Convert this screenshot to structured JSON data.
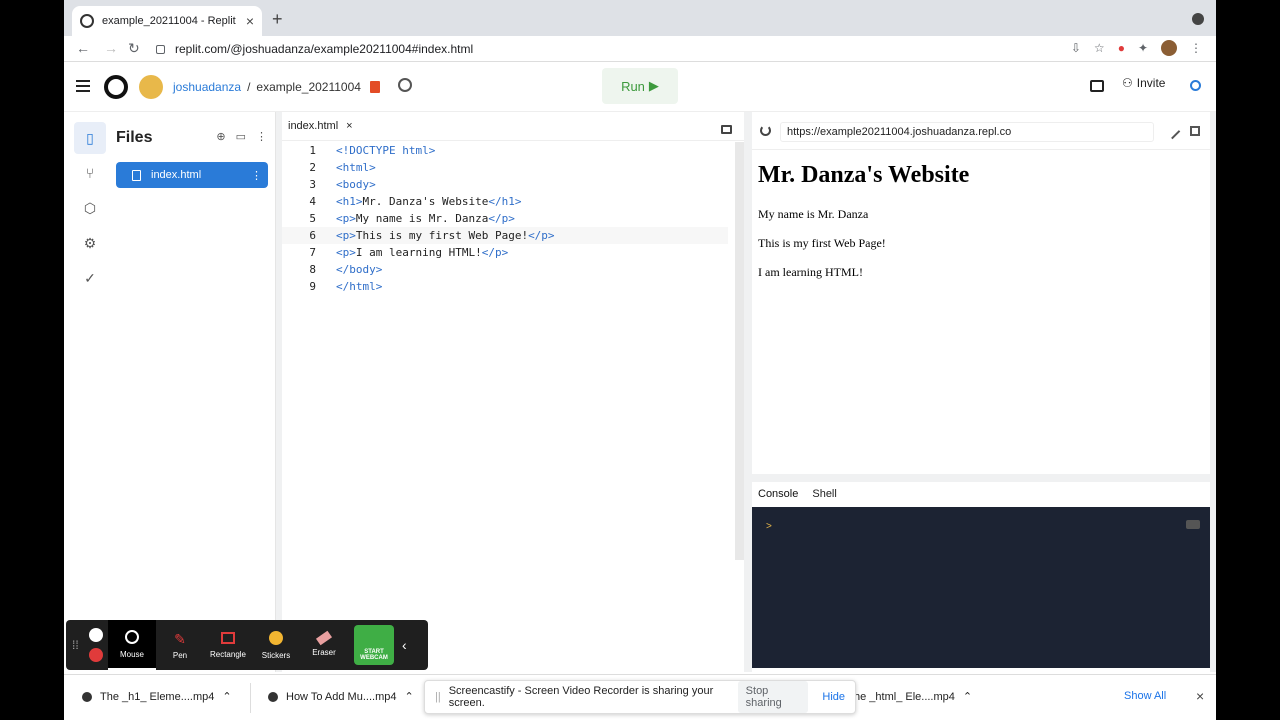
{
  "browser": {
    "tab_title": "example_20211004 - Replit",
    "tab_close": "×",
    "new_tab": "+",
    "url": "replit.com/@joshuadanza/example20211004#index.html"
  },
  "header": {
    "username": "joshuadanza",
    "separator": "/",
    "repl_name": "example_20211004",
    "run_label": "Run",
    "run_glyph": "▶",
    "invite_label": "Invite"
  },
  "files": {
    "title": "Files",
    "items": [
      {
        "label": "index.html"
      }
    ]
  },
  "editor": {
    "tab_label": "index.html",
    "tab_close": "×",
    "lines": [
      {
        "n": "1",
        "html": "<!DOCTYPE html>"
      },
      {
        "n": "2",
        "html": "<html>"
      },
      {
        "n": "3",
        "html": "<body>"
      },
      {
        "n": "4",
        "html": "<h1>Mr. Danza's Website</h1>"
      },
      {
        "n": "5",
        "html": "<p>My name is Mr. Danza</p>"
      },
      {
        "n": "6",
        "html": "<p>This is my first Web Page!</p>"
      },
      {
        "n": "7",
        "html": "<p>I am learning HTML!</p>"
      },
      {
        "n": "8",
        "html": "</body>"
      },
      {
        "n": "9",
        "html": "</html>"
      }
    ],
    "current_line": 6
  },
  "preview": {
    "url": "https://example20211004.joshuadanza.repl.co",
    "heading": "Mr. Danza's Website",
    "paragraphs": [
      "My name is Mr. Danza",
      "This is my first Web Page!",
      "I am learning HTML!"
    ]
  },
  "console": {
    "tabs": [
      "Console",
      "Shell"
    ],
    "prompt": ">"
  },
  "screencastify": {
    "tools": [
      "Mouse",
      "Pen",
      "Rectangle",
      "Stickers",
      "Eraser"
    ],
    "webcam_label": "START WEBCAM",
    "share_message": "Screencastify - Screen Video Recorder is sharing your screen.",
    "stop_sharing": "Stop sharing",
    "hide": "Hide"
  },
  "downloads": {
    "items": [
      "The _h1_ Eleme....mp4",
      "How To Add Mu....mp4",
      "he _html_ Ele....mp4"
    ],
    "show_all": "Show All",
    "close": "×"
  },
  "colors": {
    "replit_blue": "#2a7bd8",
    "run_green": "#3d9a3d",
    "console_bg": "#1c2333",
    "tag_blue": "#2f6ec9"
  }
}
